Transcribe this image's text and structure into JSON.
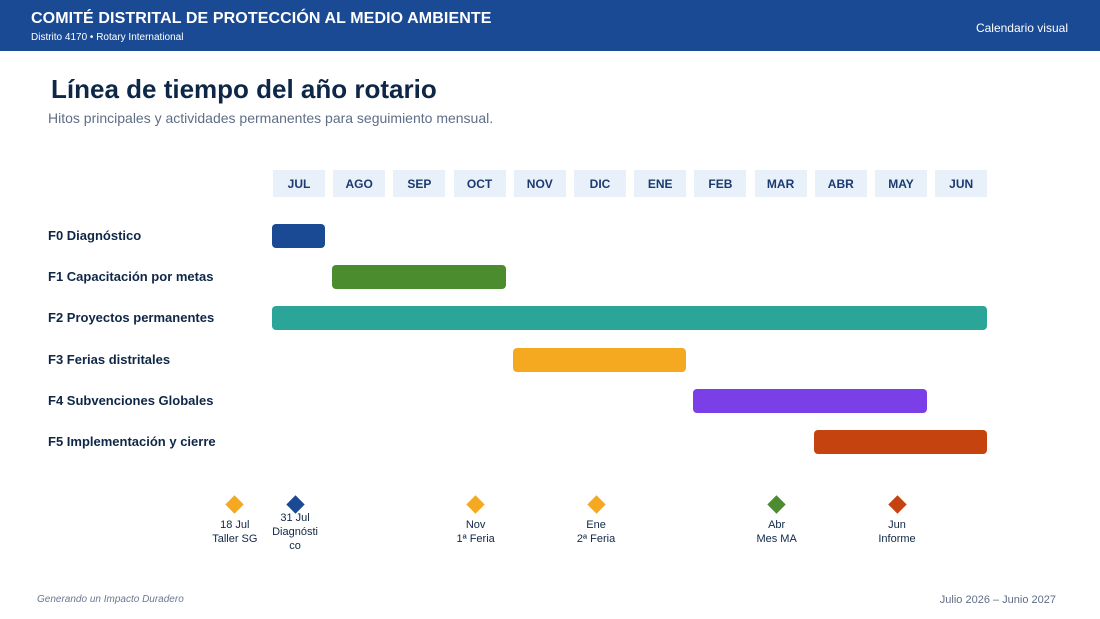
{
  "header": {
    "org_title": "COMITÉ DISTRITAL DE PROTECCIÓN AL MEDIO AMBIENTE",
    "org_subtitle": "Distrito 4170 • Rotary International",
    "right_label": "Calendario visual"
  },
  "page": {
    "title": "Línea de tiempo del año rotario",
    "subtitle": "Hitos principales y actividades permanentes para seguimiento mensual."
  },
  "footer": {
    "left": "Generando un Impacto Duradero",
    "right": "Julio 2026 – Junio 2027"
  },
  "chart_data": {
    "type": "gantt",
    "months": [
      "JUL",
      "AGO",
      "SEP",
      "OCT",
      "NOV",
      "DIC",
      "ENE",
      "FEB",
      "MAR",
      "ABR",
      "MAY",
      "JUN"
    ],
    "phases": [
      {
        "label": "F0 Diagnóstico",
        "start": 0,
        "end": 1,
        "color": "#1b4a94"
      },
      {
        "label": "F1 Capacitación por metas",
        "start": 1,
        "end": 4,
        "color": "#4a8c2e"
      },
      {
        "label": "F2 Proyectos permanentes",
        "start": 0,
        "end": 12,
        "color": "#2ba597"
      },
      {
        "label": "F3 Ferias distritales",
        "start": 4,
        "end": 7,
        "color": "#f5a920"
      },
      {
        "label": "F4 Subvenciones Globales",
        "start": 7,
        "end": 11,
        "color": "#7b3fe8"
      },
      {
        "label": "F5 Implementación y cierre",
        "start": 9,
        "end": 12,
        "color": "#c4430f"
      }
    ],
    "milestones": [
      {
        "month": -0.8,
        "color": "#f5a920",
        "line1": "18 Jul",
        "line2": "Taller SG",
        "line3": ""
      },
      {
        "month": 0.2,
        "color": "#1b4a94",
        "line1": "31 Jul",
        "line2": "Diagnósti",
        "line3": "co"
      },
      {
        "month": 3.2,
        "color": "#f5a920",
        "line1": "Nov",
        "line2": "1ª Feria",
        "line3": ""
      },
      {
        "month": 5.2,
        "color": "#f5a920",
        "line1": "Ene",
        "line2": "2ª Feria",
        "line3": ""
      },
      {
        "month": 8.2,
        "color": "#4a8c2e",
        "line1": "Abr",
        "line2": "Mes MA",
        "line3": ""
      },
      {
        "month": 10.2,
        "color": "#c4430f",
        "line1": "Jun",
        "line2": "Informe",
        "line3": ""
      }
    ]
  }
}
